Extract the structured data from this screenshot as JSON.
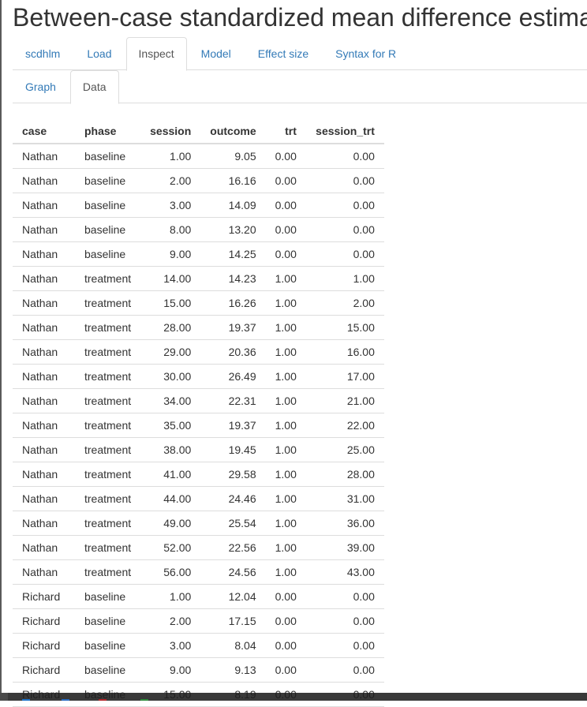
{
  "title": "Between-case standardized mean difference estimator",
  "main_tabs": [
    {
      "label": "scdhlm",
      "active": false
    },
    {
      "label": "Load",
      "active": false
    },
    {
      "label": "Inspect",
      "active": true
    },
    {
      "label": "Model",
      "active": false
    },
    {
      "label": "Effect size",
      "active": false
    },
    {
      "label": "Syntax for R",
      "active": false
    }
  ],
  "sub_tabs": [
    {
      "label": "Graph",
      "active": false
    },
    {
      "label": "Data",
      "active": true
    }
  ],
  "table": {
    "columns": [
      "case",
      "phase",
      "session",
      "outcome",
      "trt",
      "session_trt"
    ],
    "rows": [
      [
        "Nathan",
        "baseline",
        "1.00",
        "9.05",
        "0.00",
        "0.00"
      ],
      [
        "Nathan",
        "baseline",
        "2.00",
        "16.16",
        "0.00",
        "0.00"
      ],
      [
        "Nathan",
        "baseline",
        "3.00",
        "14.09",
        "0.00",
        "0.00"
      ],
      [
        "Nathan",
        "baseline",
        "8.00",
        "13.20",
        "0.00",
        "0.00"
      ],
      [
        "Nathan",
        "baseline",
        "9.00",
        "14.25",
        "0.00",
        "0.00"
      ],
      [
        "Nathan",
        "treatment",
        "14.00",
        "14.23",
        "1.00",
        "1.00"
      ],
      [
        "Nathan",
        "treatment",
        "15.00",
        "16.26",
        "1.00",
        "2.00"
      ],
      [
        "Nathan",
        "treatment",
        "28.00",
        "19.37",
        "1.00",
        "15.00"
      ],
      [
        "Nathan",
        "treatment",
        "29.00",
        "20.36",
        "1.00",
        "16.00"
      ],
      [
        "Nathan",
        "treatment",
        "30.00",
        "26.49",
        "1.00",
        "17.00"
      ],
      [
        "Nathan",
        "treatment",
        "34.00",
        "22.31",
        "1.00",
        "21.00"
      ],
      [
        "Nathan",
        "treatment",
        "35.00",
        "19.37",
        "1.00",
        "22.00"
      ],
      [
        "Nathan",
        "treatment",
        "38.00",
        "19.45",
        "1.00",
        "25.00"
      ],
      [
        "Nathan",
        "treatment",
        "41.00",
        "29.58",
        "1.00",
        "28.00"
      ],
      [
        "Nathan",
        "treatment",
        "44.00",
        "24.46",
        "1.00",
        "31.00"
      ],
      [
        "Nathan",
        "treatment",
        "49.00",
        "25.54",
        "1.00",
        "36.00"
      ],
      [
        "Nathan",
        "treatment",
        "52.00",
        "22.56",
        "1.00",
        "39.00"
      ],
      [
        "Nathan",
        "treatment",
        "56.00",
        "24.56",
        "1.00",
        "43.00"
      ],
      [
        "Richard",
        "baseline",
        "1.00",
        "12.04",
        "0.00",
        "0.00"
      ],
      [
        "Richard",
        "baseline",
        "2.00",
        "17.15",
        "0.00",
        "0.00"
      ],
      [
        "Richard",
        "baseline",
        "3.00",
        "8.04",
        "0.00",
        "0.00"
      ],
      [
        "Richard",
        "baseline",
        "9.00",
        "9.13",
        "0.00",
        "0.00"
      ],
      [
        "Richard",
        "baseline",
        "15.00",
        "8.19",
        "0.00",
        "0.00"
      ]
    ]
  },
  "colors": {
    "link": "#337ab7",
    "active_tab_text": "#555555",
    "text": "#333333",
    "border": "#dddddd"
  }
}
